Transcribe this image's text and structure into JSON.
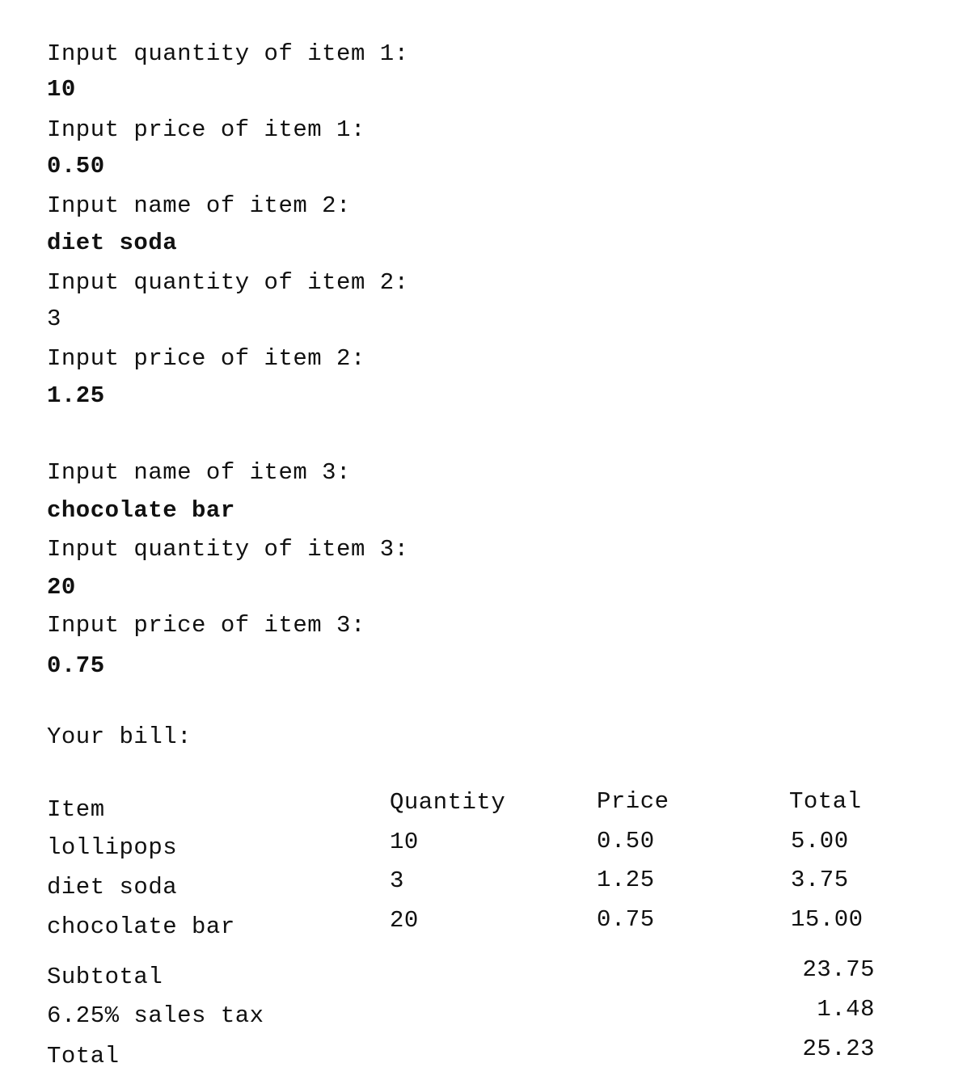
{
  "session": {
    "lines": [
      {
        "text": "Input quantity of item 1:",
        "kind": "prompt"
      },
      {
        "text": "10",
        "kind": "input"
      },
      {
        "text": "Input price of item 1:",
        "kind": "prompt"
      },
      {
        "text": "0.50",
        "kind": "input"
      },
      {
        "text": "Input name of item 2:",
        "kind": "prompt"
      },
      {
        "text": "diet soda",
        "kind": "input"
      },
      {
        "text": "Input quantity of item 2:",
        "kind": "prompt"
      },
      {
        "text": "3",
        "kind": "output"
      },
      {
        "text": "Input price of item 2:",
        "kind": "prompt"
      },
      {
        "text": "1.25",
        "kind": "input"
      },
      {
        "text": "Input name of item 3:",
        "kind": "prompt"
      },
      {
        "text": "chocolate bar",
        "kind": "input"
      },
      {
        "text": "Input quantity of item 3:",
        "kind": "prompt"
      },
      {
        "text": "20",
        "kind": "input"
      },
      {
        "text": "Input price of item 3:",
        "kind": "prompt"
      },
      {
        "text": "0.75",
        "kind": "input"
      },
      {
        "text": "Your bill:",
        "kind": "prompt"
      }
    ]
  },
  "bill": {
    "headers": {
      "item": "Item",
      "quantity": "Quantity",
      "price": "Price",
      "total": "Total"
    },
    "rows": [
      {
        "item": "lollipops",
        "quantity": "10",
        "price": "0.50",
        "total": "5.00"
      },
      {
        "item": "diet soda",
        "quantity": "3",
        "price": "1.25",
        "total": "3.75"
      },
      {
        "item": "chocolate bar",
        "quantity": "20",
        "price": "0.75",
        "total": "15.00"
      }
    ],
    "summary": [
      {
        "label": "Subtotal",
        "value": "23.75"
      },
      {
        "label": "6.25% sales tax",
        "value": "1.48"
      },
      {
        "label": "Total",
        "value": "25.23"
      }
    ]
  }
}
